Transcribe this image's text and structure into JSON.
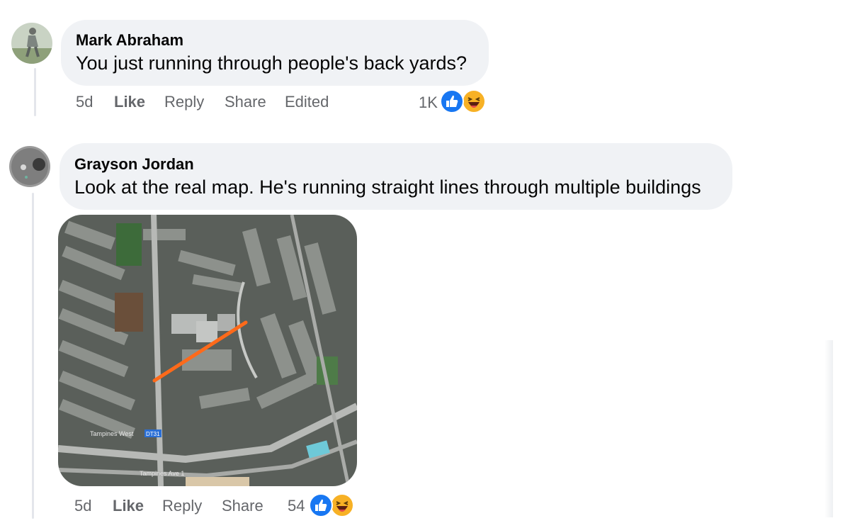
{
  "comments": [
    {
      "author": "Mark Abraham",
      "text": "You just running through people's back yards?",
      "time": "5d",
      "actions": {
        "like": "Like",
        "reply": "Reply",
        "share": "Share",
        "edited": "Edited"
      },
      "reaction_count": "1K",
      "reactions": [
        "like-icon",
        "haha-icon"
      ]
    },
    {
      "author": "Grayson Jordan",
      "text": "Look at the real map. He's running straight lines through multiple buildings",
      "time": "5d",
      "actions": {
        "like": "Like",
        "reply": "Reply",
        "share": "Share"
      },
      "reaction_count": "54",
      "reactions": [
        "like-icon",
        "haha-icon"
      ],
      "attachment": {
        "type": "satellite-map",
        "labels": [
          "Tampines West",
          "DT31",
          "Tampines Ave 1"
        ]
      }
    }
  ],
  "colors": {
    "bubble": "#f0f2f5",
    "meta_text": "#65676b",
    "like_blue": "#1877f2",
    "haha_yellow": "#f7b125",
    "route_orange": "#ff6a1a"
  }
}
